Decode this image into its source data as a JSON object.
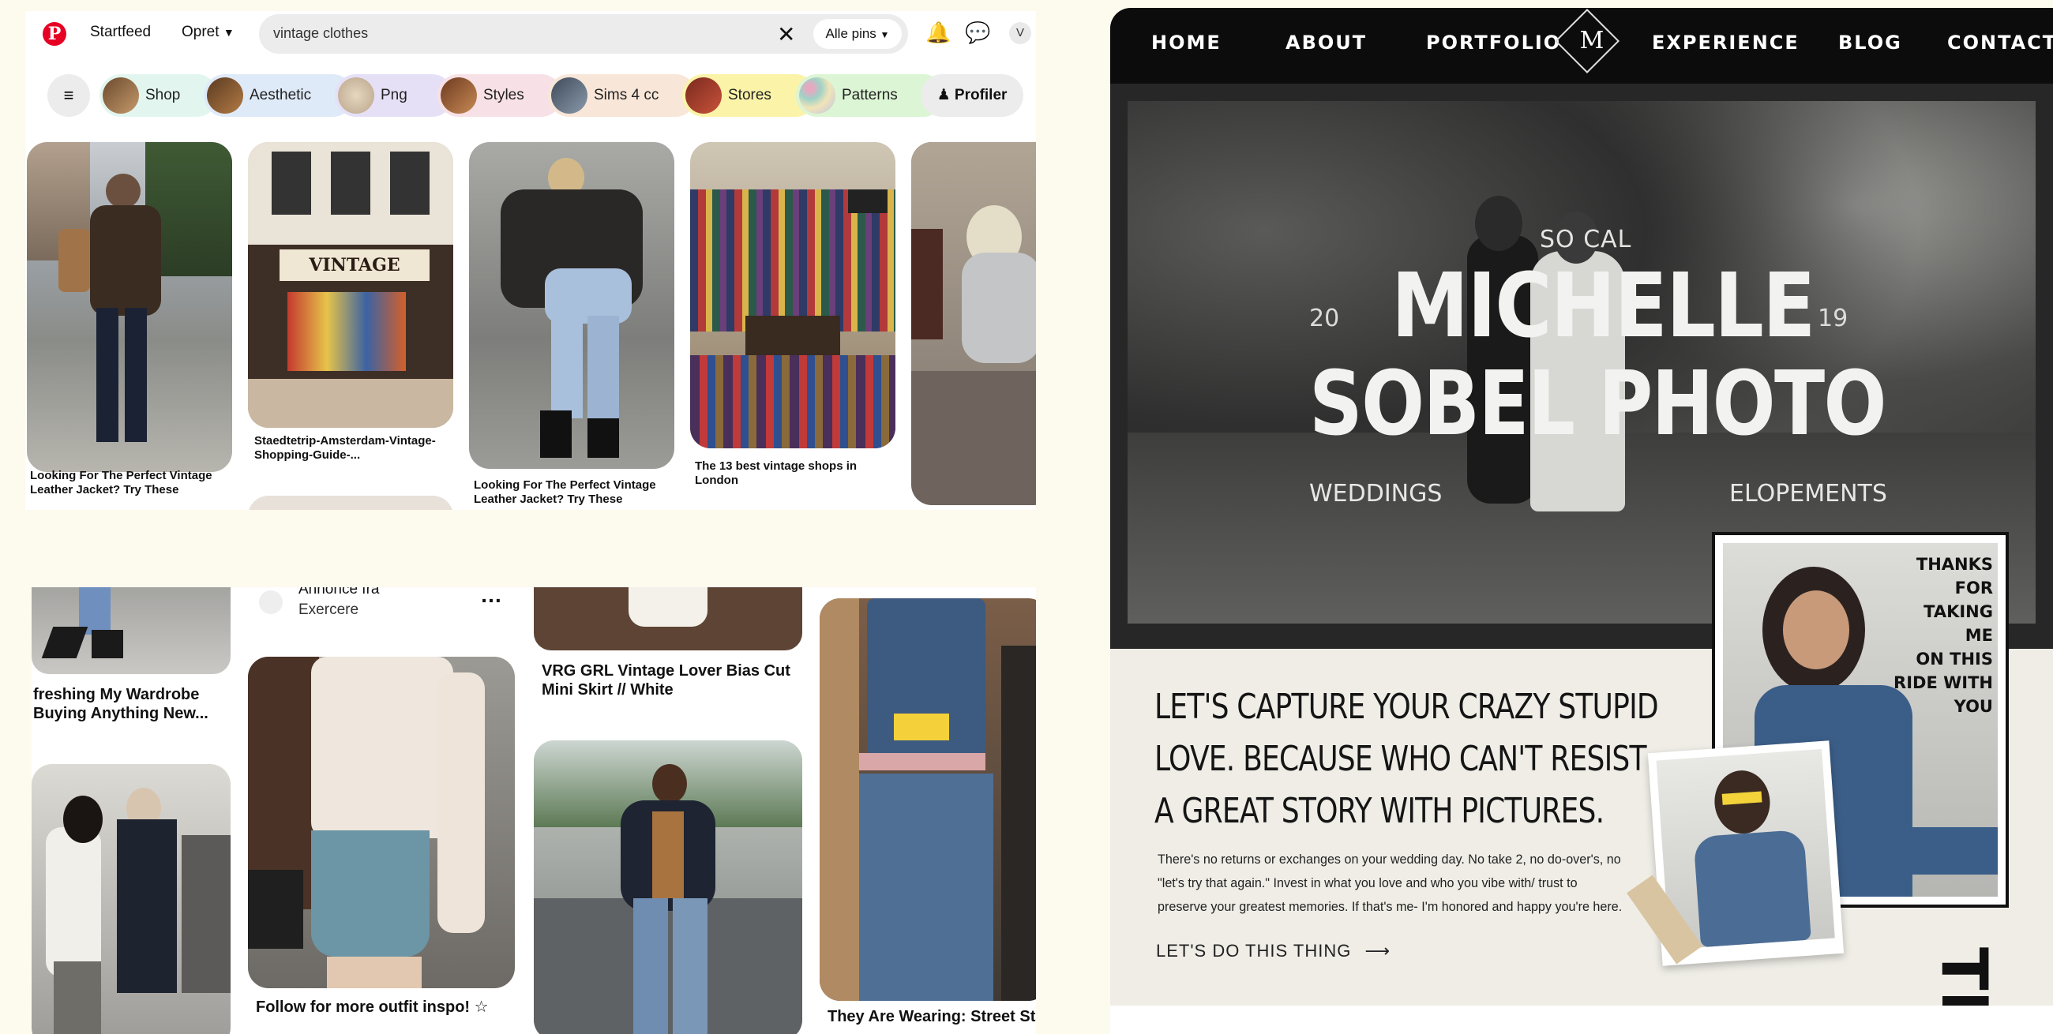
{
  "pinterest_top": {
    "nav": {
      "home": "Startfeed",
      "create": "Opret"
    },
    "search": {
      "query": "vintage clothes",
      "filter": "Alle pins"
    },
    "avatar_initial": "V",
    "chips": [
      "Shop",
      "Aesthetic",
      "Png",
      "Styles",
      "Sims 4 cc",
      "Stores",
      "Patterns"
    ],
    "profiles_label": "Profiler",
    "captions": {
      "pin1": "Looking For The Perfect Vintage Leather Jacket? Try These",
      "pin2": "Staedtetrip-Amsterdam-Vintage-Shopping-Guide-...",
      "pin3": "Looking For The Perfect Vintage Leather Jacket? Try These",
      "pin4": "The 13 best vintage shops in London"
    },
    "shop_sign": "VINTAGE"
  },
  "pinterest_bottom": {
    "captions": {
      "pin1": "freshing My Wardrobe Buying Anything New...",
      "ad_title": "Annonce fra",
      "ad_source": "Exercere",
      "pin3": "VRG GRL Vintage Lover Bias Cut Mini Skirt // White",
      "pin2": "Follow for more outfit inspo! ☆",
      "pin4": "They Are Wearing: Street St"
    }
  },
  "site": {
    "nav": [
      "HOME",
      "ABOUT",
      "PORTFOLIO",
      "EXPERIENCE",
      "BLOG",
      "CONTACT"
    ],
    "logo": "M",
    "hero": {
      "kicker": "SO CAL",
      "year_left": "20",
      "year_right": "19",
      "title_line1": "MICHELLE",
      "title_line2": "SOBEL PHOTO",
      "left_label": "WEDDINGS",
      "right_label": "ELOPEMENTS"
    },
    "tagline": [
      "LET'S CAPTURE YOUR CRAZY STUPID",
      "LOVE. BECAUSE WHO CAN'T RESIST",
      "A GREAT STORY WITH PICTURES."
    ],
    "body": "There's no returns or exchanges on your wedding day. No take 2, no do-over's, no \"let's try that again.\" Invest in what you love and who you vibe with/ trust to preserve your greatest memories. If that's me- I'm honored and happy you're here.",
    "cta": "LET'S DO THIS THING",
    "photo_note": [
      "THANKS",
      "FOR",
      "TAKING ME",
      "ON THIS",
      "RIDE WITH",
      "YOU"
    ],
    "side_text": "THI"
  }
}
